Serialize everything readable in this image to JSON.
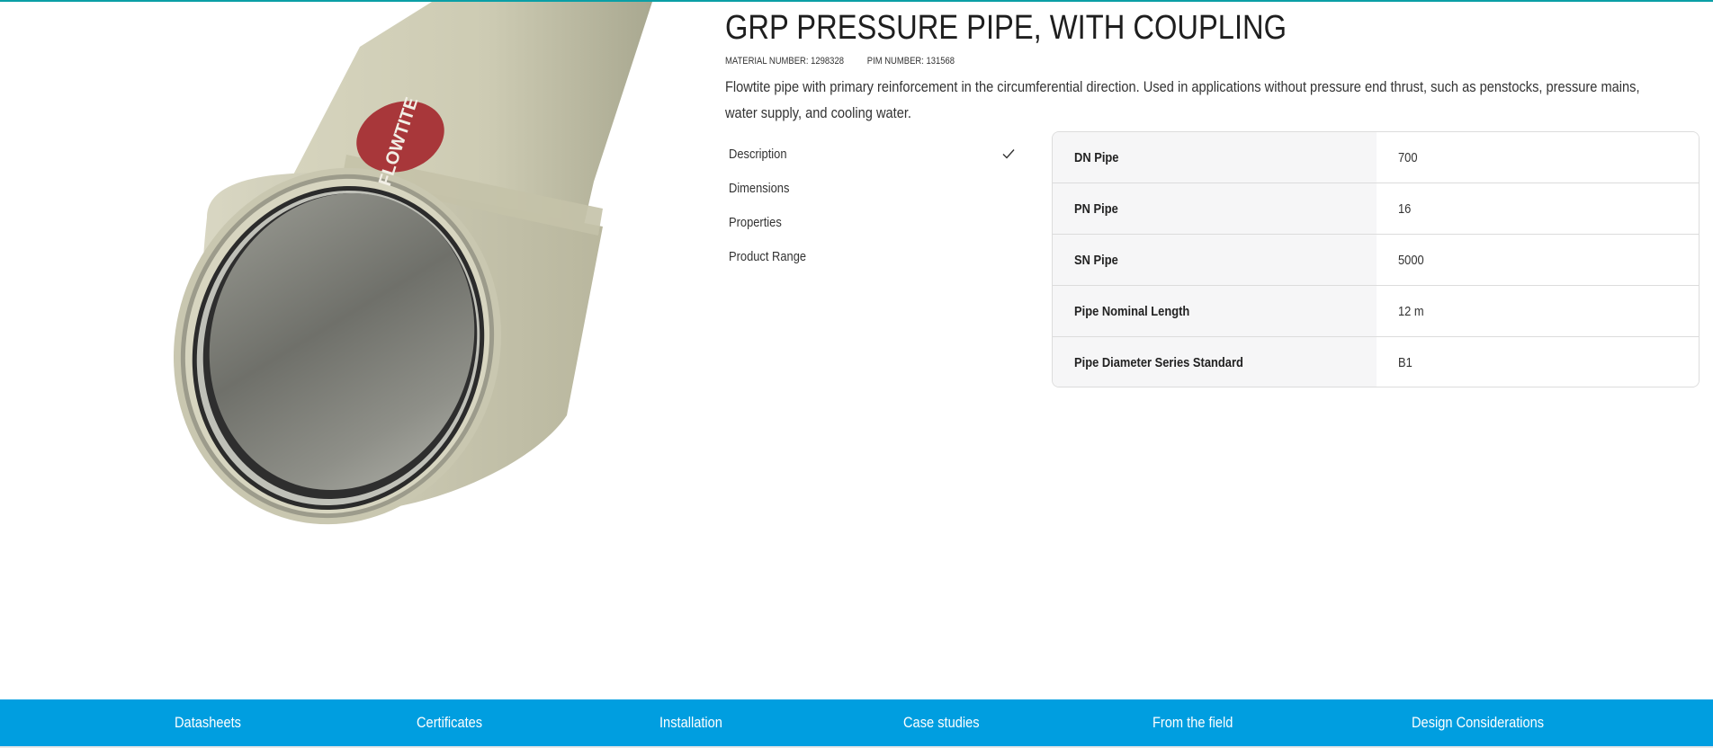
{
  "product": {
    "title": "GRP PRESSURE PIPE, WITH COUPLING",
    "material_number": "MATERIAL NUMBER: 1298328",
    "pim_number": "PIM NUMBER: 131568",
    "description": "Flowtite pipe with primary reinforcement in the circumferential direction. Used in applications without pressure end thrust, such as penstocks, pressure mains, water supply, and cooling water.",
    "image_logo_text": "FLOWTITE"
  },
  "spec_nav": [
    {
      "label": "Description",
      "active": true,
      "icon": "check-icon"
    },
    {
      "label": "Dimensions"
    },
    {
      "label": "Properties"
    },
    {
      "label": "Product Range"
    }
  ],
  "spec_table": [
    {
      "key": "DN Pipe",
      "value": "700"
    },
    {
      "key": "PN Pipe",
      "value": "16"
    },
    {
      "key": "SN Pipe",
      "value": "5000"
    },
    {
      "key": "Pipe Nominal Length",
      "value": "12 m"
    },
    {
      "key": "Pipe Diameter Series Standard",
      "value": "B1"
    }
  ],
  "bottom_nav": [
    "Datasheets",
    "Certificates",
    "Installation",
    "Case studies",
    "From the field",
    "Design Considerations"
  ],
  "colors": {
    "accent_bar": "#009ee0",
    "top_line": "#0a9fa6",
    "pipe_body": "#cfcdb5",
    "logo_red": "#a8373a"
  }
}
